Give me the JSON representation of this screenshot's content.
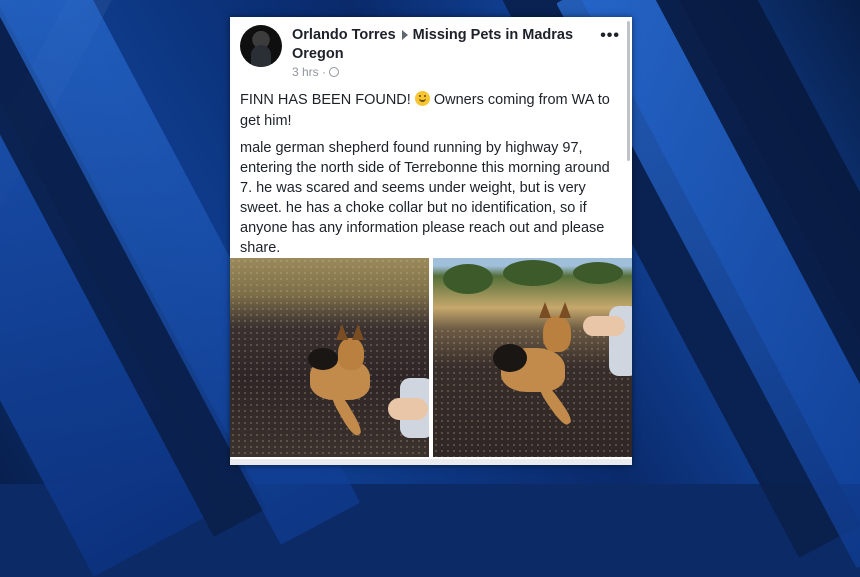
{
  "post": {
    "author": "Orlando Torres",
    "group": "Missing Pets in Madras Oregon",
    "time": "3 hrs ·",
    "more_label": "•••",
    "headline_pre": "FINN HAS BEEN FOUND!",
    "headline_post": "Owners coming from WA to get him!",
    "body": "male german shepherd found running by highway 97, entering the north side of Terrebonne this morning around 7. he was scared and seems under weight, but is very sweet. he has a choke collar but no identification, so if anyone has any information please reach out and please share."
  },
  "icons": {
    "arrow": "caret-right-icon",
    "privacy": "globe-icon",
    "emoji": "smiley-icon"
  },
  "colors": {
    "background": "#0e3c8c",
    "card": "#ffffff",
    "text": "#1d2129",
    "meta": "#90949c"
  }
}
